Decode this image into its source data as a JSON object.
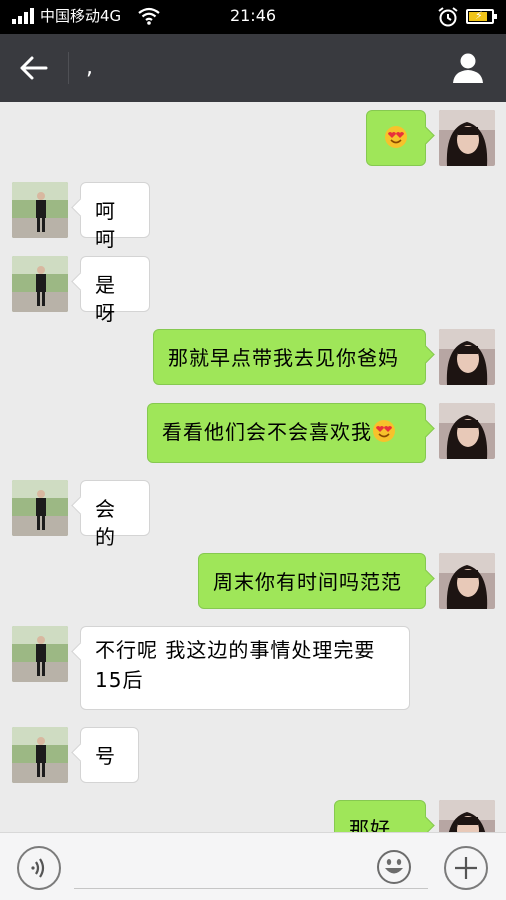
{
  "status_bar": {
    "carrier": "中国移动4G",
    "time": "21:46",
    "battery_level": 0.8
  },
  "header": {
    "title": ",",
    "back_icon": "back-arrow-icon",
    "profile_icon": "person-icon"
  },
  "messages": [
    {
      "side": "out",
      "text": "",
      "emoji": "heart-eyes-emoji"
    },
    {
      "side": "in",
      "text": "呵呵"
    },
    {
      "side": "in",
      "text": "是呀"
    },
    {
      "side": "out",
      "text": "那就早点带我去见你爸妈"
    },
    {
      "side": "out",
      "text": "看看他们会不会喜欢我",
      "emoji": "heart-eyes-emoji"
    },
    {
      "side": "in",
      "text": "会的"
    },
    {
      "side": "out",
      "text": "周末你有时间吗范范"
    },
    {
      "side": "in",
      "text": "不行呢 我这边的事情处理完要",
      "text2": "15后"
    },
    {
      "side": "in",
      "text": "号"
    },
    {
      "side": "out",
      "text": "那好吧"
    }
  ],
  "input_bar": {
    "voice_icon": "voice-icon",
    "input_value": "",
    "emoji_icon": "smiley-icon",
    "plus_icon": "plus-icon"
  },
  "colors": {
    "background": "#ebebeb",
    "header": "#393a3f",
    "outgoing_bubble": "#9fe659",
    "incoming_bubble": "#ffffff"
  }
}
